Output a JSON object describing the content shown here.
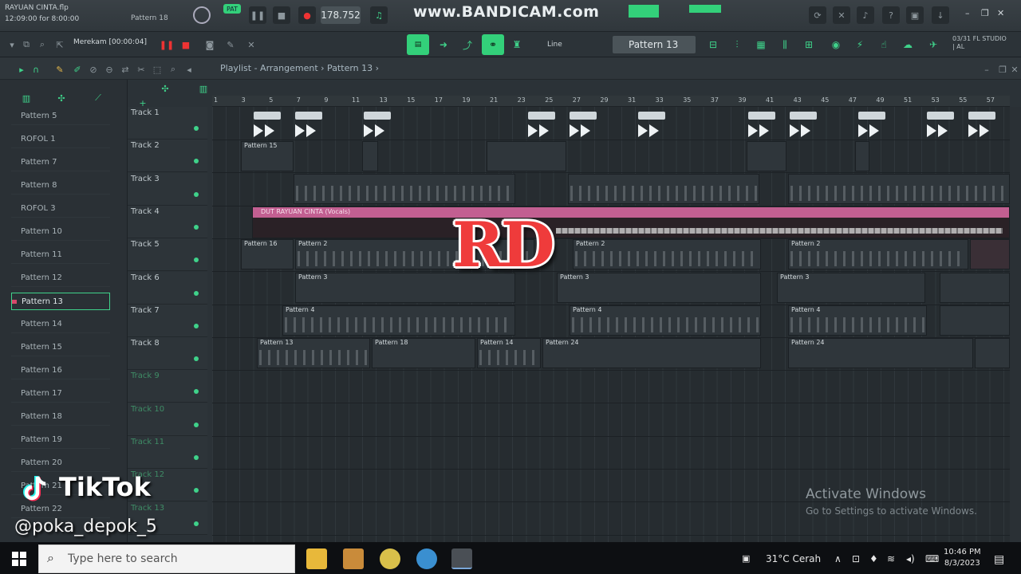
{
  "titlebar": {
    "project_file": "RAYUAN CINTA.flp",
    "project_time": "12:09:00 for 8:00:00",
    "pattern_name": "Pattern 18",
    "tempo": "178.752",
    "watermark": "www.BANDICAM.com"
  },
  "recorder": {
    "label": "Merekam [00:00:04]"
  },
  "toolbar": {
    "snap_mode": "Line",
    "current_pattern": "Pattern 13",
    "version_label": "03/31 FL STUDIO | AL"
  },
  "playlist": {
    "breadcrumb": "Playlist - Arrangement › Pattern 13 ›",
    "ruler": [
      "1",
      "3",
      "5",
      "7",
      "9",
      "11",
      "13",
      "15",
      "17",
      "19",
      "21",
      "23",
      "25",
      "27",
      "29",
      "31",
      "33",
      "35",
      "37",
      "39",
      "41",
      "43",
      "45",
      "47",
      "49",
      "51",
      "53",
      "55",
      "57"
    ]
  },
  "picker": {
    "items": [
      "Pattern 5",
      "ROFOL 1",
      "Pattern 7",
      "Pattern 8",
      "ROFOL 3",
      "Pattern 10",
      "Pattern 11",
      "Pattern 12",
      "Pattern 13",
      "Pattern 14",
      "Pattern 15",
      "Pattern 16",
      "Pattern 17",
      "Pattern 18",
      "Pattern 19",
      "Pattern 20",
      "Pattern 21",
      "Pattern 22"
    ],
    "selected": "Pattern 13"
  },
  "tracks": [
    "Track 1",
    "Track 2",
    "Track 3",
    "Track 4",
    "Track 5",
    "Track 6",
    "Track 7",
    "Track 8",
    "Track 9",
    "Track 10",
    "Track 11",
    "Track 12",
    "Track 13"
  ],
  "clips": {
    "t2a": "Pattern 15",
    "vocal": "DUT RAYUAN CINTA (Vocals)",
    "t5a": "Pattern 16",
    "t5b": "Pattern 2",
    "t5c": "Pattern 2",
    "t5d": "Pattern 2",
    "t6a": "Pattern 3",
    "t6b": "Pattern 3",
    "t6c": "Pattern 3",
    "t7a": "Pattern 4",
    "t7b": "Pattern 4",
    "t7c": "Pattern 4",
    "t8a": "Pattern 13",
    "t8b": "Pattern 18",
    "t8c": "Pattern 14",
    "t8d": "Pattern 24",
    "t8e": "Pattern 24"
  },
  "overlay": {
    "logo_text": "RD",
    "tiktok_label": "TikTok",
    "tiktok_handle": "@poka_depok_5",
    "activate_title": "Activate Windows",
    "activate_sub": "Go to Settings to activate Windows."
  },
  "taskbar": {
    "search_placeholder": "Type here to search",
    "weather": "31°C  Cerah",
    "time": "10:46 PM",
    "date": "8/3/2023"
  },
  "colors": {
    "accent_green": "#3fd28a",
    "vocal_pink": "#c25f91",
    "logo_red": "#ef3b3b"
  }
}
